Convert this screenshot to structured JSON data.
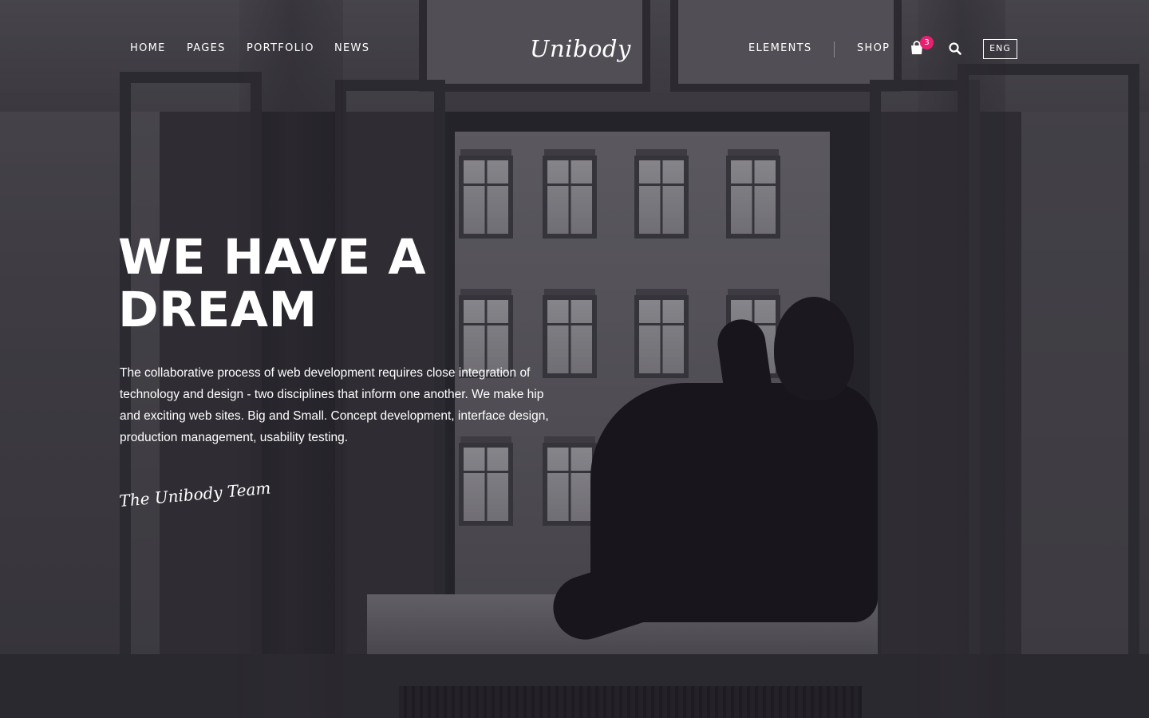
{
  "header": {
    "nav_left": [
      {
        "label": "HOME"
      },
      {
        "label": "PAGES"
      },
      {
        "label": "PORTFOLIO"
      },
      {
        "label": "NEWS"
      }
    ],
    "logo": "Unibody",
    "nav_right": [
      {
        "label": "ELEMENTS"
      },
      {
        "label": "SHOP"
      }
    ],
    "cart": {
      "icon": "shopping-bag-icon",
      "count": "3",
      "badge_color": "#e8206f"
    },
    "search": {
      "icon": "search-icon"
    },
    "language": "ENG"
  },
  "hero": {
    "title": "WE HAVE A DREAM",
    "text": "The collaborative process of web development requires close integration of technology and design - two disciplines that inform one another. We make hip and exciting web sites. Big and Small. Concept development, interface design, production management, usability testing.",
    "signature": "The Unibody Team"
  },
  "colors": {
    "text": "#ffffff",
    "accent": "#e8206f",
    "overlay": "#1c1a22"
  }
}
